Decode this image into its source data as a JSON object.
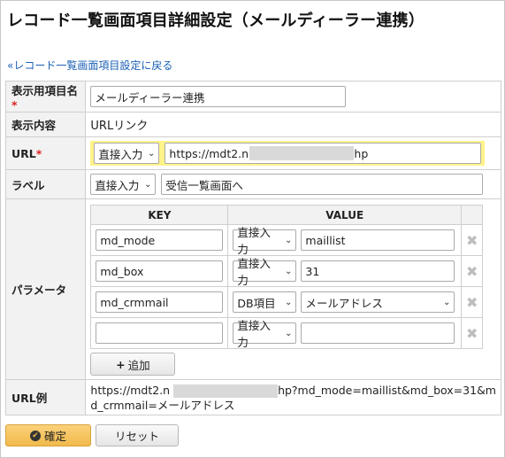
{
  "page": {
    "title": "レコード一覧画面項目詳細設定（メールディーラー連携）",
    "back_link": "«レコード一覧画面項目設定に戻る"
  },
  "fields": {
    "display_name_label": "表示用項目名",
    "display_name_value": "メールディーラー連携",
    "content_label": "表示内容",
    "content_value": "URLリンク",
    "url_label": "URL",
    "url_mode": "直接入力",
    "url_value_prefix": "https://mdt2.n",
    "url_value_suffix": "hp",
    "label_label": "ラベル",
    "label_mode": "直接入力",
    "label_value": "受信一覧画面へ",
    "required_mark": "*"
  },
  "params": {
    "label": "パラメータ",
    "header_key": "KEY",
    "header_value": "VALUE",
    "rows": [
      {
        "key": "md_mode",
        "mode": "直接入力",
        "value": "maillist"
      },
      {
        "key": "md_box",
        "mode": "直接入力",
        "value": "31"
      },
      {
        "key": "md_crmmail",
        "mode": "DB項目",
        "value": "メールアドレス"
      },
      {
        "key": "",
        "mode": "直接入力",
        "value": ""
      }
    ],
    "add_button": "追加",
    "delete_symbol": "✖"
  },
  "example": {
    "label": "URL例",
    "line1_prefix": "https://mdt2.n",
    "line1_suffix": "hp?md_mode=maillist&md_box=31&m",
    "line2": "d_crmmail=メールアドレス"
  },
  "buttons": {
    "confirm": "確定",
    "reset": "リセット"
  },
  "colors": {
    "highlight": "#fff38a",
    "required": "#dd2222",
    "link": "#1a5fb4",
    "confirm": "#f0b94b"
  }
}
